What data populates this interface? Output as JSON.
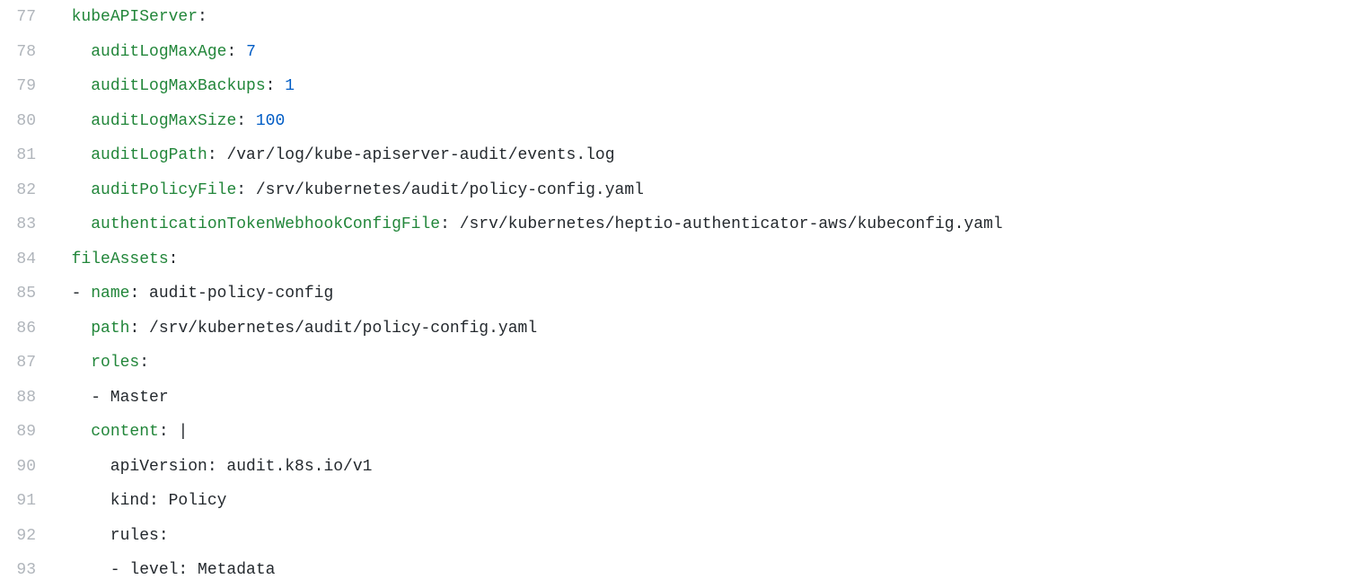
{
  "lines": [
    {
      "num": "77",
      "segments": [
        {
          "text": "  ",
          "cls": ""
        },
        {
          "text": "kubeAPIServer",
          "cls": "key"
        },
        {
          "text": ":",
          "cls": "punct"
        }
      ]
    },
    {
      "num": "78",
      "segments": [
        {
          "text": "    ",
          "cls": ""
        },
        {
          "text": "auditLogMaxAge",
          "cls": "key"
        },
        {
          "text": ": ",
          "cls": "punct"
        },
        {
          "text": "7",
          "cls": "num"
        }
      ]
    },
    {
      "num": "79",
      "segments": [
        {
          "text": "    ",
          "cls": ""
        },
        {
          "text": "auditLogMaxBackups",
          "cls": "key"
        },
        {
          "text": ": ",
          "cls": "punct"
        },
        {
          "text": "1",
          "cls": "num"
        }
      ]
    },
    {
      "num": "80",
      "segments": [
        {
          "text": "    ",
          "cls": ""
        },
        {
          "text": "auditLogMaxSize",
          "cls": "key"
        },
        {
          "text": ": ",
          "cls": "punct"
        },
        {
          "text": "100",
          "cls": "num"
        }
      ]
    },
    {
      "num": "81",
      "segments": [
        {
          "text": "    ",
          "cls": ""
        },
        {
          "text": "auditLogPath",
          "cls": "key"
        },
        {
          "text": ": ",
          "cls": "punct"
        },
        {
          "text": "/var/log/kube-apiserver-audit/events.log",
          "cls": "str"
        }
      ]
    },
    {
      "num": "82",
      "segments": [
        {
          "text": "    ",
          "cls": ""
        },
        {
          "text": "auditPolicyFile",
          "cls": "key"
        },
        {
          "text": ": ",
          "cls": "punct"
        },
        {
          "text": "/srv/kubernetes/audit/policy-config.yaml",
          "cls": "str"
        }
      ]
    },
    {
      "num": "83",
      "segments": [
        {
          "text": "    ",
          "cls": ""
        },
        {
          "text": "authenticationTokenWebhookConfigFile",
          "cls": "key"
        },
        {
          "text": ": ",
          "cls": "punct"
        },
        {
          "text": "/srv/kubernetes/heptio-authenticator-aws/kubeconfig.yaml",
          "cls": "str"
        }
      ]
    },
    {
      "num": "84",
      "segments": [
        {
          "text": "  ",
          "cls": ""
        },
        {
          "text": "fileAssets",
          "cls": "key"
        },
        {
          "text": ":",
          "cls": "punct"
        }
      ]
    },
    {
      "num": "85",
      "segments": [
        {
          "text": "  - ",
          "cls": "dash"
        },
        {
          "text": "name",
          "cls": "key"
        },
        {
          "text": ": ",
          "cls": "punct"
        },
        {
          "text": "audit-policy-config",
          "cls": "str"
        }
      ]
    },
    {
      "num": "86",
      "segments": [
        {
          "text": "    ",
          "cls": ""
        },
        {
          "text": "path",
          "cls": "key"
        },
        {
          "text": ": ",
          "cls": "punct"
        },
        {
          "text": "/srv/kubernetes/audit/policy-config.yaml",
          "cls": "str"
        }
      ]
    },
    {
      "num": "87",
      "segments": [
        {
          "text": "    ",
          "cls": ""
        },
        {
          "text": "roles",
          "cls": "key"
        },
        {
          "text": ":",
          "cls": "punct"
        }
      ]
    },
    {
      "num": "88",
      "segments": [
        {
          "text": "    - Master",
          "cls": "str"
        }
      ]
    },
    {
      "num": "89",
      "segments": [
        {
          "text": "    ",
          "cls": ""
        },
        {
          "text": "content",
          "cls": "key"
        },
        {
          "text": ": ",
          "cls": "punct"
        },
        {
          "text": "|",
          "cls": "pipe"
        }
      ]
    },
    {
      "num": "90",
      "segments": [
        {
          "text": "      apiVersion: audit.k8s.io/v1",
          "cls": "str"
        }
      ]
    },
    {
      "num": "91",
      "segments": [
        {
          "text": "      kind: Policy",
          "cls": "str"
        }
      ]
    },
    {
      "num": "92",
      "segments": [
        {
          "text": "      rules:",
          "cls": "str"
        }
      ]
    },
    {
      "num": "93",
      "segments": [
        {
          "text": "      - level: Metadata",
          "cls": "str"
        }
      ]
    }
  ]
}
